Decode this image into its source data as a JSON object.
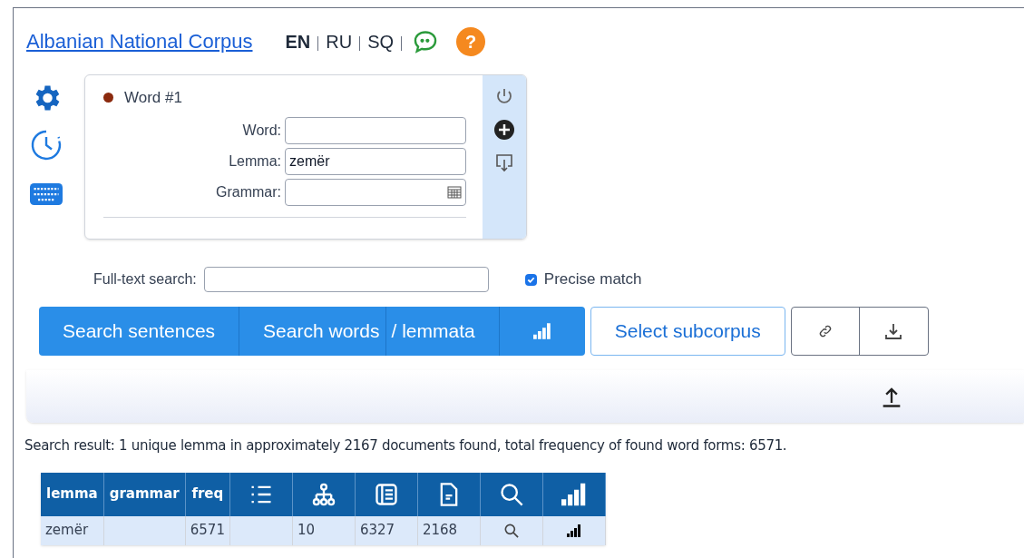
{
  "header": {
    "title": "Albanian National Corpus",
    "languages": [
      {
        "label": "EN",
        "selected": true
      },
      {
        "label": "RU",
        "selected": false
      },
      {
        "label": "SQ",
        "selected": false
      }
    ],
    "help_button": "?"
  },
  "word_block": {
    "title": "Word #1",
    "color": "#8b2a0e",
    "fields": [
      {
        "label": "Word:",
        "kind": "text"
      },
      {
        "label": "Lemma:",
        "kind": "text",
        "value": "zemër"
      },
      {
        "label": "Grammar:",
        "kind": "picker"
      }
    ]
  },
  "full_text_search": {
    "label": "Full-text search:"
  },
  "precise_match": {
    "label": "Precise match",
    "checked": true
  },
  "search_buttons": [
    "Search sentences",
    "Search words",
    "/ lemmata"
  ],
  "subcorpus_button": "Select subcorpus",
  "result_text": "Search result: 1 unique lemma in approximately 2167 documents found, total frequency of found word forms: 6571.",
  "table": {
    "columns": [
      {
        "kind": "text",
        "label": "lemma"
      },
      {
        "kind": "text",
        "label": "grammar"
      },
      {
        "kind": "text",
        "label": "freq"
      },
      {
        "kind": "icon"
      },
      {
        "kind": "icon"
      },
      {
        "kind": "icon"
      },
      {
        "kind": "icon"
      },
      {
        "kind": "icon"
      },
      {
        "kind": "icon"
      }
    ],
    "rows": [
      {
        "cells": [
          {
            "kind": "text",
            "text": "zemër"
          },
          {
            "kind": "empty"
          },
          {
            "kind": "text",
            "text": "6571"
          },
          {
            "kind": "empty"
          },
          {
            "kind": "text",
            "text": "10"
          },
          {
            "kind": "text",
            "text": "6327"
          },
          {
            "kind": "text",
            "text": "2168"
          },
          {
            "kind": "icon"
          },
          {
            "kind": "icon"
          }
        ]
      }
    ]
  }
}
